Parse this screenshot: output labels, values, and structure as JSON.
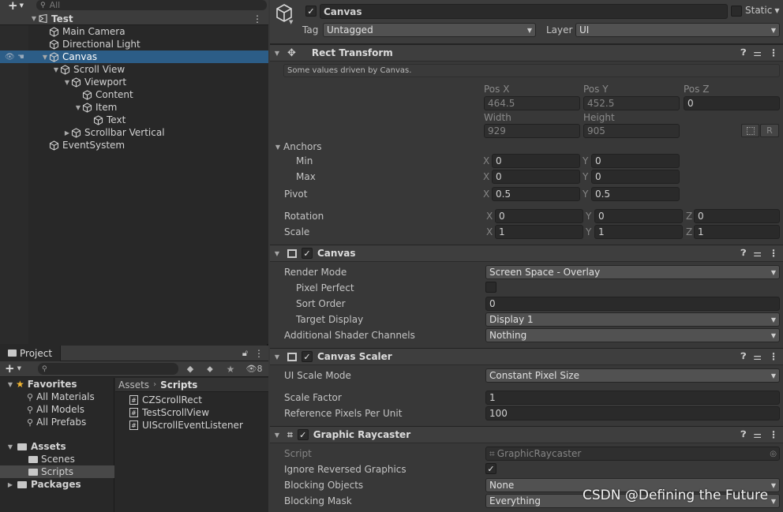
{
  "hierarchy": {
    "add_label": "+",
    "search_placeholder": "All",
    "items": [
      {
        "label": "Test",
        "depth": 0,
        "expand": "open",
        "icon": "scene-icon",
        "bold": true
      },
      {
        "label": "Main Camera",
        "depth": 1,
        "expand": "none",
        "icon": "gameobject-cube-icon"
      },
      {
        "label": "Directional Light",
        "depth": 1,
        "expand": "none",
        "icon": "gameobject-cube-icon"
      },
      {
        "label": "Canvas",
        "depth": 1,
        "expand": "open",
        "icon": "gameobject-cube-icon",
        "selected": true
      },
      {
        "label": "Scroll View",
        "depth": 2,
        "expand": "open",
        "icon": "gameobject-cube-icon"
      },
      {
        "label": "Viewport",
        "depth": 3,
        "expand": "open",
        "icon": "gameobject-cube-icon"
      },
      {
        "label": "Content",
        "depth": 4,
        "expand": "none",
        "icon": "gameobject-cube-icon"
      },
      {
        "label": "Item",
        "depth": 4,
        "expand": "open",
        "icon": "gameobject-cube-icon"
      },
      {
        "label": "Text",
        "depth": 5,
        "expand": "none",
        "icon": "gameobject-cube-icon"
      },
      {
        "label": "Scrollbar Vertical",
        "depth": 3,
        "expand": "closed",
        "icon": "gameobject-cube-icon"
      },
      {
        "label": "EventSystem",
        "depth": 1,
        "expand": "none",
        "icon": "gameobject-cube-icon"
      }
    ]
  },
  "project": {
    "tab_label": "Project",
    "hidden_count": "8",
    "favorites_label": "Favorites",
    "favorites": [
      "All Materials",
      "All Models",
      "All Prefabs"
    ],
    "assets_label": "Assets",
    "asset_folders": [
      "Scenes",
      "Scripts"
    ],
    "packages_label": "Packages",
    "breadcrumb_root": "Assets",
    "breadcrumb_current": "Scripts",
    "files": [
      "CZScrollRect",
      "TestScrollView",
      "UIScrollEventListener"
    ]
  },
  "inspector": {
    "object_name": "Canvas",
    "static_label": "Static",
    "tag_label": "Tag",
    "tag_value": "Untagged",
    "layer_label": "Layer",
    "layer_value": "UI",
    "rect_transform": {
      "title": "Rect Transform",
      "info": "Some values driven by Canvas.",
      "pos_x_label": "Pos X",
      "pos_x": "464.5",
      "pos_y_label": "Pos Y",
      "pos_y": "452.5",
      "pos_z_label": "Pos Z",
      "pos_z": "0",
      "width_label": "Width",
      "width": "929",
      "height_label": "Height",
      "height": "905",
      "r_button": "R",
      "anchors_label": "Anchors",
      "min_label": "Min",
      "min_x": "0",
      "min_y": "0",
      "max_label": "Max",
      "max_x": "0",
      "max_y": "0",
      "pivot_label": "Pivot",
      "pivot_x": "0.5",
      "pivot_y": "0.5",
      "rotation_label": "Rotation",
      "rot_x": "0",
      "rot_y": "0",
      "rot_z": "0",
      "scale_label": "Scale",
      "scale_x": "1",
      "scale_y": "1",
      "scale_z": "1",
      "x": "X",
      "y": "Y",
      "z": "Z"
    },
    "canvas": {
      "title": "Canvas",
      "render_mode_label": "Render Mode",
      "render_mode": "Screen Space - Overlay",
      "pixel_perfect_label": "Pixel Perfect",
      "sort_order_label": "Sort Order",
      "sort_order": "0",
      "target_display_label": "Target Display",
      "target_display": "Display 1",
      "shader_channels_label": "Additional Shader Channels",
      "shader_channels": "Nothing"
    },
    "canvas_scaler": {
      "title": "Canvas Scaler",
      "scale_mode_label": "UI Scale Mode",
      "scale_mode": "Constant Pixel Size",
      "scale_factor_label": "Scale Factor",
      "scale_factor": "1",
      "ref_pixels_label": "Reference Pixels Per Unit",
      "ref_pixels": "100"
    },
    "graphic_raycaster": {
      "title": "Graphic Raycaster",
      "script_label": "Script",
      "script_value": "GraphicRaycaster",
      "ignore_reversed_label": "Ignore Reversed Graphics",
      "blocking_objects_label": "Blocking Objects",
      "blocking_objects": "None",
      "blocking_mask_label": "Blocking Mask",
      "blocking_mask": "Everything"
    }
  },
  "watermark": "CSDN @Defining the Future",
  "colors": {
    "selection": "#2c5d87",
    "panel": "#383838",
    "dark_panel": "#282828"
  }
}
